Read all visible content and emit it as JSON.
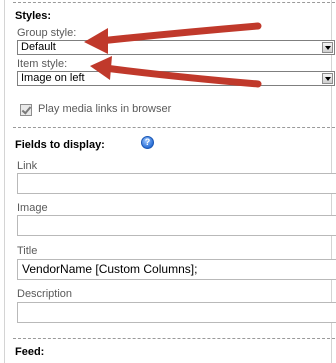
{
  "styles": {
    "heading": "Styles:",
    "group_style_label": "Group style:",
    "group_style_value": "Default",
    "item_style_label": "Item style:",
    "item_style_value": "Image on left",
    "play_media_label": "Play media links in browser",
    "play_media_checked": true
  },
  "fields": {
    "heading": "Fields to display:",
    "help_glyph": "?",
    "link_label": "Link",
    "link_value": "",
    "image_label": "Image",
    "image_value": "",
    "title_label": "Title",
    "title_value": "VendorName [Custom Columns];",
    "description_label": "Description",
    "description_value": ""
  },
  "feed": {
    "heading": "Feed:"
  },
  "annotation_color": "#c0392b"
}
